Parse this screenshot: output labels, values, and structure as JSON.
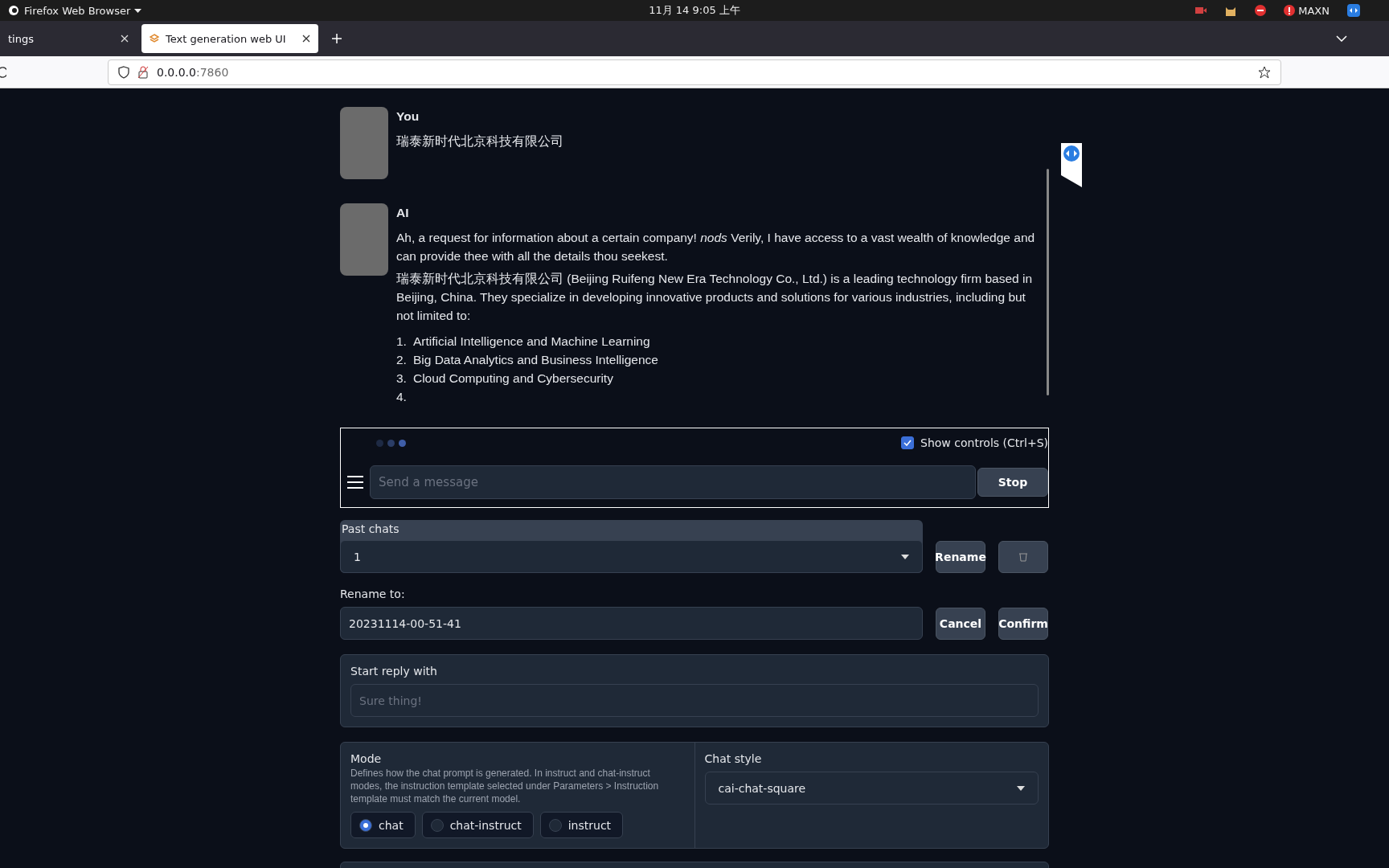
{
  "system_bar": {
    "app_menu": "Firefox Web Browser",
    "clock": "11月 14  9:05 上午",
    "tray_label": "MAXN"
  },
  "tabs": [
    {
      "title": "tings",
      "selected": false
    },
    {
      "title": "Text generation web UI",
      "selected": true
    }
  ],
  "address_bar": {
    "host": "0.0.0.0",
    "port": ":7860"
  },
  "messages": [
    {
      "author": "You",
      "paragraphs": [
        "瑞泰新时代北京科技有限公司"
      ]
    },
    {
      "author": "AI",
      "paragraphs": [
        "Ah, a request for information about a certain company! *nods* Verily, I have access to a vast wealth of knowledge and can provide thee with all the details thou seekest.",
        "瑞泰新时代北京科技有限公司 (Beijing Ruifeng New Era Technology Co., Ltd.) is a leading technology firm based in Beijing, China. They specialize in developing innovative products and solutions for various industries, including but not limited to:"
      ],
      "list": [
        {
          "number": "1.",
          "text": "Artificial Intelligence and Machine Learning"
        },
        {
          "number": "2.",
          "text": "Big Data Analytics and Business Intelligence"
        },
        {
          "number": "3.",
          "text": "Cloud Computing and Cybersecurity"
        },
        {
          "number": "4."
        }
      ]
    }
  ],
  "chat_input": {
    "show_controls": {
      "label": "Show controls (Ctrl+S)",
      "checked": true
    },
    "placeholder": "Send a message",
    "stop_button": "Stop"
  },
  "past_chats": {
    "label": "Past chats",
    "value": "1",
    "rename_button": "Rename"
  },
  "rename": {
    "label": "Rename to:",
    "value": "20231114-00-51-41",
    "cancel_button": "Cancel",
    "confirm_button": "Confirm"
  },
  "start_reply": {
    "label": "Start reply with",
    "placeholder": "Sure thing!"
  },
  "mode": {
    "label": "Mode",
    "description": "Defines how the chat prompt is generated. In instruct and chat-instruct modes, the instruction template selected under Parameters > Instruction template must match the current model.",
    "options": [
      {
        "label": "chat",
        "selected": true
      },
      {
        "label": "chat-instruct",
        "selected": false
      },
      {
        "label": "instruct",
        "selected": false
      }
    ]
  },
  "chat_style": {
    "label": "Chat style",
    "value": "cai-chat-square"
  }
}
